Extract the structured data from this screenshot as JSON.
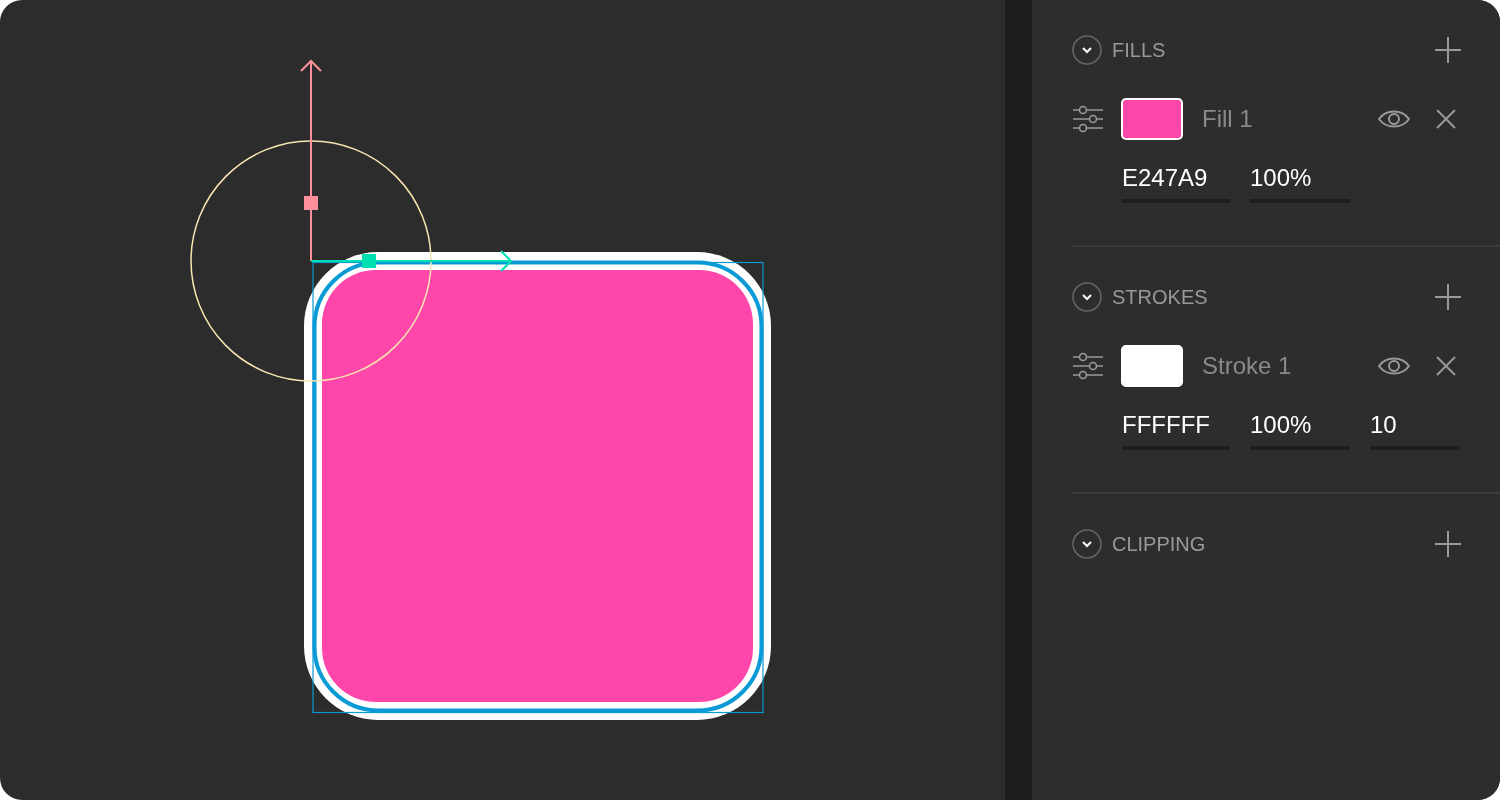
{
  "sections": [
    {
      "title": "FILLS",
      "expanded": true,
      "items": [
        {
          "name": "Fill 1",
          "color": "#ff47ab",
          "fields": [
            "E247A9",
            "100%"
          ]
        }
      ]
    },
    {
      "title": "STROKES",
      "expanded": true,
      "items": [
        {
          "name": "Stroke 1",
          "color": "#ffffff",
          "fields": [
            "FFFFFF",
            "100%",
            "10"
          ]
        }
      ]
    },
    {
      "title": "CLIPPING",
      "expanded": true
    }
  ]
}
